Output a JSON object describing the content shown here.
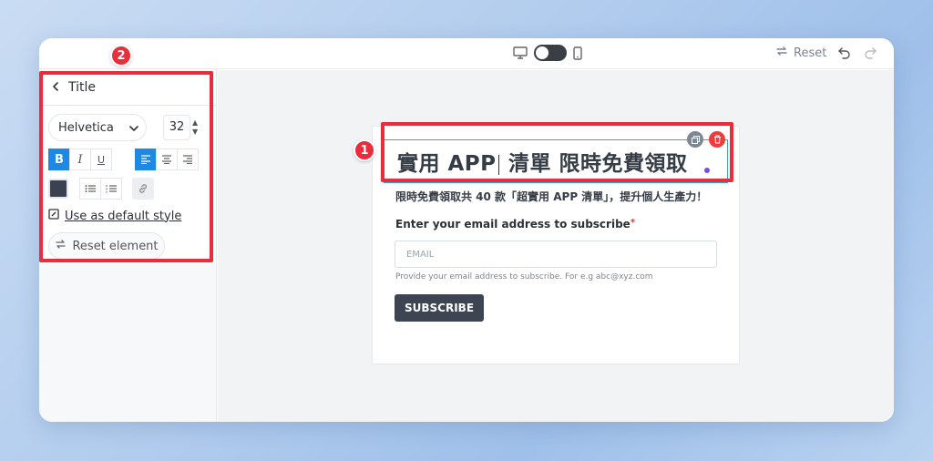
{
  "topbar": {
    "reset_label": "Reset"
  },
  "sidebar": {
    "panel_title": "Title",
    "font_family": "Helvetica",
    "font_size": "32",
    "format_buttons": [
      "B",
      "I",
      "U"
    ],
    "use_default_label": "Use as default style",
    "reset_element_label": "Reset element",
    "text_color": "#3a4250"
  },
  "form": {
    "title_part1": "實用 APP",
    "title_part2": " 清單 限時免費領取",
    "subtitle": "限時免費領取共 40 款「超實用 APP 清單」，提升個人生產力！",
    "email_label": "Enter your email address to subscribe",
    "required_mark": "*",
    "email_placeholder": "EMAIL",
    "helper_text": "Provide your email address to subscribe. For e.g abc@xyz.com",
    "subscribe_label": "SUBSCRIBE"
  },
  "annotations": {
    "badge_1": "1",
    "badge_2": "2",
    "highlight_color": "#e82d3c"
  },
  "colors": {
    "accent_blue": "#1e88e5",
    "button_dark": "#3d4452",
    "delete_red": "#ef3b3b"
  }
}
